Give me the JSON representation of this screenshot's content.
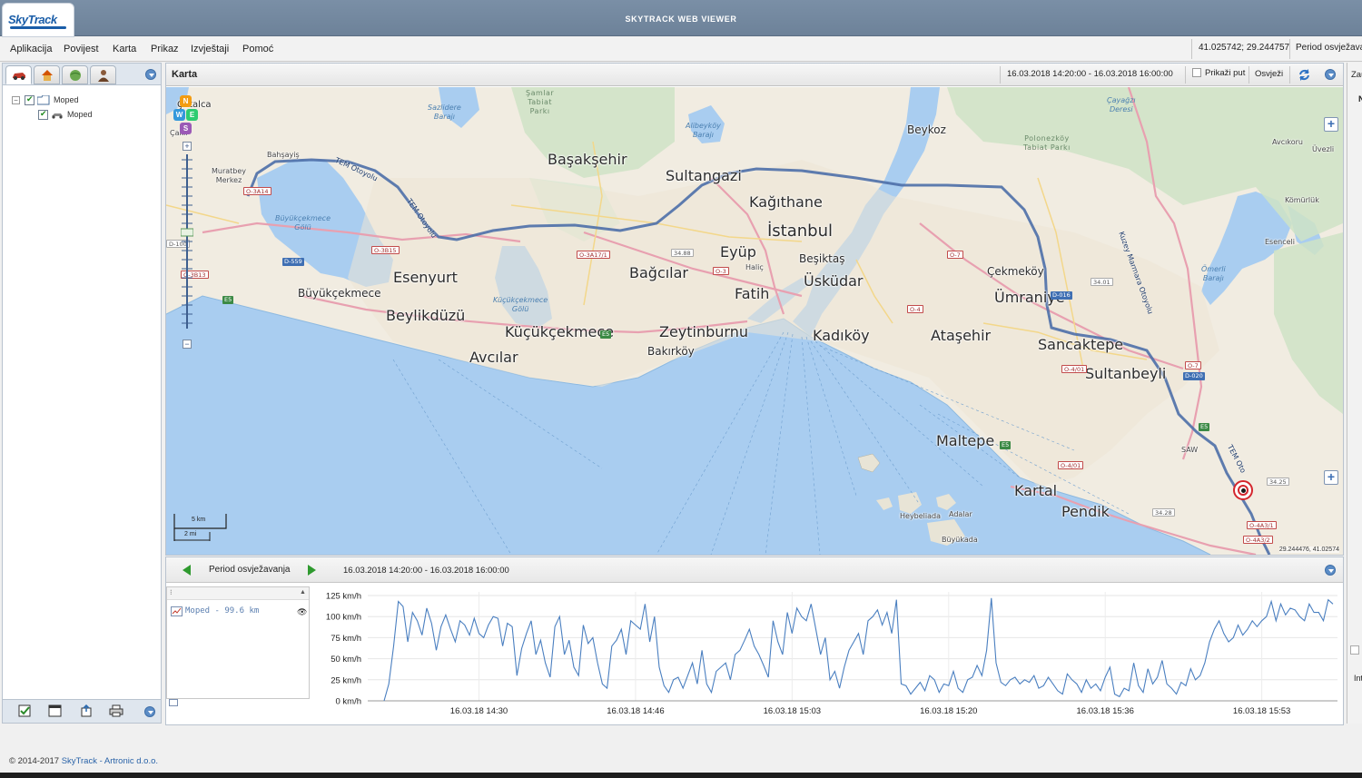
{
  "app": {
    "logo_text": "SkyTrack",
    "title": "SKYTRACK WEB VIEWER"
  },
  "menubar": {
    "items": [
      "Aplikacija",
      "Povijest",
      "Karta",
      "Prikaz",
      "Izvještaji",
      "Pomoć"
    ],
    "coordinates": "41.025742; 29.244757",
    "period_label": "Period osvježava"
  },
  "left_panel": {
    "tabs": [
      "vehicles-tab",
      "places-tab",
      "areas-tab",
      "drivers-tab"
    ],
    "tree": {
      "group_label": "Moped",
      "vehicle_label": "Moped"
    },
    "footer_buttons": [
      "check-all-icon",
      "open-window-icon",
      "export-icon",
      "print-icon"
    ]
  },
  "map": {
    "title": "Karta",
    "period": "16.03.2018 14:20:00 - 16.03.2018 16:00:00",
    "show_route_label": "Prikaži put",
    "refresh_label": "Osvježi",
    "coords_readout": "29.244476, 41.02574",
    "scale_km": "5 km",
    "scale_mi": "2 mi",
    "compass": [
      "N",
      "W",
      "E",
      "S"
    ],
    "places": {
      "catalca": "Çatalca",
      "cakil": "Çakıl",
      "bahsayis": "Bahşayiş",
      "muratbey": "Muratbey\nMerkez",
      "samlar": "Şamlar\nTabiat\nParkı",
      "sazlidere": "Sazlidere\nBarajı",
      "alibeykoy": "Alibeyköy\nBarajı",
      "cayagzi": "Çayağzı\nDeresi",
      "beykoz": "Beykoz",
      "polonezkoy": "Polonezköy\nTabiat Parkı",
      "avcikoru": "Avcıkoru",
      "uvezli": "Üvezli",
      "komurluk": "Kömürlük",
      "esenceli": "Esenceli",
      "omerli": "Ömerli\nBarajı",
      "basaksehir": "Başakşehir",
      "sultangazi": "Sultangazi",
      "kagithane": "Kağıthane",
      "istanbul": "İstanbul",
      "buyukcekmece_golu": "Büyükçekmece\nGölü",
      "esenyurt": "Esenyurt",
      "bagcilar": "Bağcılar",
      "eyup": "Eyüp",
      "besiktas": "Beşiktaş",
      "halic": "Haliç",
      "cekmekoy": "Çekmeköy",
      "buyukcekmece": "Büyükçekmece",
      "beylikduzu": "Beylikdüzü",
      "fatih": "Fatih",
      "uskudar": "Üsküdar",
      "umraniye": "Ümraniye",
      "kucukcekmece_golu": "Küçükçekmece\nGölü",
      "kucukcekmece": "Küçükçekmece",
      "zeytinburnu": "Zeytinburnu",
      "kadikoy": "Kadıköy",
      "atasehir": "Ataşehir",
      "sancaktepe": "Sancaktepe",
      "bakirkoy": "Bakırköy",
      "avcilar": "Avcılar",
      "sultanbeyli": "Sultanbeyli",
      "maltepe": "Maltepe",
      "saw": "SAW",
      "kartal": "Kartal",
      "pendik": "Pendik",
      "heybeliada": "Heybeliada",
      "adalar": "Adalar",
      "buyukada": "Büyükada"
    },
    "road_labels": {
      "tem1": "TEM Otoyolu",
      "tem2": "TEM Otoyolu",
      "kuzey": "Kuzey Marmara Otoyolu",
      "tem3": "TEM Oto"
    },
    "shields": {
      "s1": "D-100",
      "s2": "O-3A14",
      "s3": "O-3B15",
      "s4": "D-559",
      "s5": "O-3B13",
      "s6": "E5",
      "s7": "O-3A17/1",
      "s8": "34.88",
      "s9": "O-3",
      "s10": "E5",
      "s11": "O-7",
      "s12": "O-4",
      "s13": "D-016",
      "s14": "34.01",
      "s15": "O-4/01",
      "s16": "O-7",
      "s17": "D-020",
      "s18": "E5",
      "s19": "O-4/01",
      "s20": "34.25",
      "s21": "34.28",
      "s22": "O-4A3/1",
      "s23": "O-4A3/2",
      "s24": "E5"
    }
  },
  "chart_panel": {
    "period_label": "Period osvježavanja",
    "period": "16.03.2018 14:20:00 - 16.03.2018 16:00:00",
    "legend_item": "Moped - 99.6 km"
  },
  "chart_data": {
    "type": "line",
    "ylabel": "",
    "xlabel": "",
    "y_unit": "km/h",
    "yticks": [
      "125 km/h",
      "100 km/h",
      "75 km/h",
      "50 km/h",
      "25 km/h",
      "0 km/h"
    ],
    "ylim": [
      0,
      125
    ],
    "xticks": [
      "16.03.18 14:30",
      "16.03.18 14:46",
      "16.03.18 15:03",
      "16.03.18 15:20",
      "16.03.18 15:36",
      "16.03.18 15:53"
    ],
    "xlim_minutes_from_1420": [
      0,
      100
    ],
    "xtick_minutes": [
      10,
      26.5,
      43,
      59.5,
      76,
      92.5
    ],
    "series": [
      {
        "name": "Moped - 99.6 km",
        "color": "#4a7fc0",
        "minutes": [
          0,
          0.5,
          1,
          1.5,
          2,
          2.5,
          3,
          3.5,
          4,
          4.5,
          5,
          5.5,
          6,
          6.5,
          7,
          7.5,
          8,
          8.5,
          9,
          9.5,
          10,
          10.5,
          11,
          11.5,
          12,
          12.5,
          13,
          13.5,
          14,
          14.5,
          15,
          15.5,
          16,
          16.5,
          17,
          17.5,
          18,
          18.5,
          19,
          19.5,
          20,
          20.5,
          21,
          21.5,
          22,
          22.5,
          23,
          23.5,
          24,
          24.5,
          25,
          25.5,
          26,
          26.5,
          27,
          27.5,
          28,
          28.5,
          29,
          29.5,
          30,
          30.5,
          31,
          31.5,
          32,
          32.5,
          33,
          33.5,
          34,
          34.5,
          35,
          35.5,
          36,
          36.5,
          37,
          37.5,
          38,
          38.5,
          39,
          39.5,
          40,
          40.5,
          41,
          41.5,
          42,
          42.5,
          43,
          43.5,
          44,
          44.5,
          45,
          45.5,
          46,
          46.5,
          47,
          47.5,
          48,
          48.5,
          49,
          49.5,
          50,
          50.5,
          51,
          51.5,
          52,
          52.5,
          53,
          53.5,
          54,
          54.5,
          55,
          55.5,
          56,
          56.5,
          57,
          57.5,
          58,
          58.5,
          59,
          59.5,
          60,
          60.5,
          61,
          61.5,
          62,
          62.5,
          63,
          63.5,
          64,
          64.5,
          65,
          65.5,
          66,
          66.5,
          67,
          67.5,
          68,
          68.5,
          69,
          69.5,
          70,
          70.5,
          71,
          71.5,
          72,
          72.5,
          73,
          73.5,
          74,
          74.5,
          75,
          75.5,
          76,
          76.5,
          77,
          77.5,
          78,
          78.5,
          79,
          79.5,
          80,
          80.5,
          81,
          81.5,
          82,
          82.5,
          83,
          83.5,
          84,
          84.5,
          85,
          85.5,
          86,
          86.5,
          87,
          87.5,
          88,
          88.5,
          89,
          89.5,
          90,
          90.5,
          91,
          91.5,
          92,
          92.5,
          93,
          93.5,
          94,
          94.5,
          95,
          95.5,
          96,
          96.5,
          97,
          97.5,
          98,
          98.5,
          99,
          99.5,
          100
        ],
        "values": [
          0,
          20,
          65,
          118,
          112,
          70,
          105,
          95,
          78,
          110,
          92,
          60,
          88,
          102,
          85,
          70,
          95,
          90,
          78,
          98,
          80,
          75,
          90,
          100,
          98,
          65,
          92,
          88,
          30,
          62,
          80,
          95,
          55,
          72,
          45,
          28,
          88,
          100,
          55,
          72,
          40,
          30,
          90,
          68,
          75,
          45,
          20,
          15,
          65,
          72,
          85,
          55,
          95,
          90,
          85,
          115,
          70,
          100,
          40,
          18,
          10,
          25,
          28,
          15,
          30,
          45,
          20,
          60,
          20,
          10,
          35,
          40,
          45,
          25,
          55,
          60,
          72,
          85,
          65,
          55,
          42,
          28,
          95,
          70,
          55,
          105,
          80,
          110,
          100,
          95,
          115,
          85,
          55,
          75,
          25,
          35,
          15,
          40,
          60,
          70,
          80,
          55,
          95,
          100,
          108,
          90,
          105,
          80,
          120,
          20,
          18,
          8,
          15,
          22,
          12,
          30,
          25,
          10,
          20,
          18,
          35,
          15,
          10,
          25,
          28,
          42,
          30,
          60,
          122,
          45,
          22,
          18,
          25,
          28,
          20,
          25,
          22,
          30,
          15,
          18,
          28,
          20,
          12,
          8,
          32,
          25,
          20,
          10,
          25,
          15,
          20,
          12,
          28,
          40,
          8,
          5,
          15,
          12,
          45,
          18,
          10,
          38,
          20,
          28,
          48,
          20,
          15,
          8,
          22,
          18,
          38,
          25,
          30,
          45,
          70,
          85,
          95,
          80,
          70,
          75,
          90,
          78,
          85,
          95,
          88,
          95,
          100,
          118,
          95,
          115,
          102,
          110,
          108,
          100,
          95,
          115,
          105,
          105,
          95,
          120,
          115
        ]
      }
    ]
  },
  "footer": {
    "copyright": "© 2014-2017",
    "company": "SkyTrack - Artronic d.o.o."
  },
  "right_strip": {
    "text1": "Zau",
    "text2": "N",
    "text3": "Int"
  }
}
